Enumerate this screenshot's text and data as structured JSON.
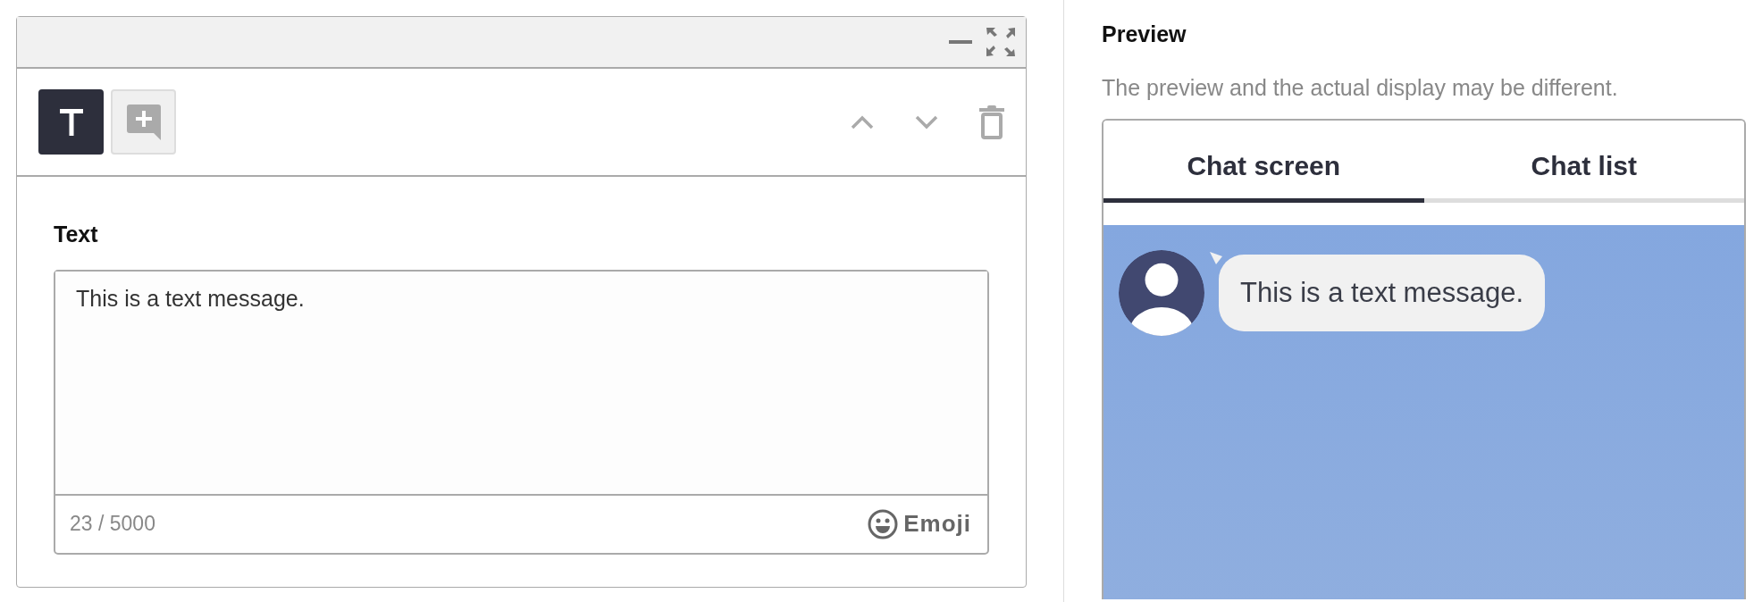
{
  "editor": {
    "message_types": [
      {
        "kind": "text",
        "selected": true
      },
      {
        "kind": "add",
        "selected": false
      }
    ],
    "field_label": "Text",
    "text_value": "This is a text message.",
    "char_count": "23 / 5000",
    "emoji_button": "Emoji"
  },
  "preview": {
    "title": "Preview",
    "note": "The preview and the actual display may be different.",
    "tabs": [
      {
        "label": "Chat screen",
        "selected": true
      },
      {
        "label": "Chat list",
        "selected": false
      }
    ],
    "messages": [
      {
        "text": "This is a text message."
      }
    ]
  }
}
